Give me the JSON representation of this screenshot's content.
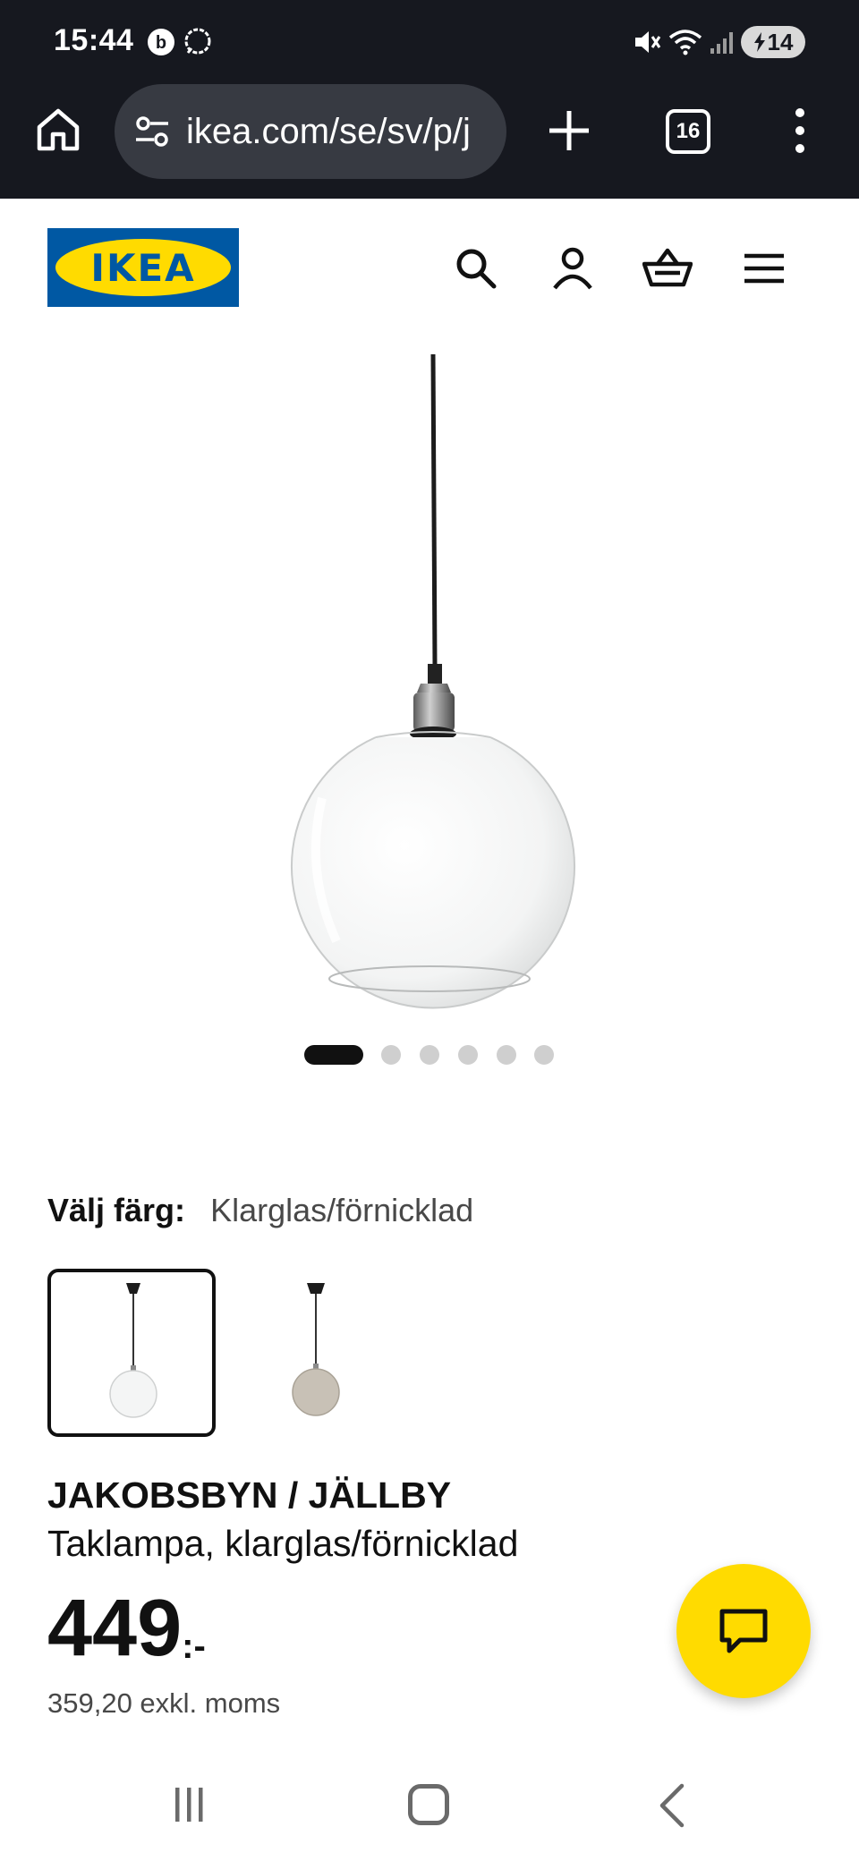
{
  "status_bar": {
    "time": "15:44",
    "battery_level": "14",
    "icons": [
      "b-app-icon",
      "signal-messenger-icon",
      "mute-icon",
      "wifi-icon",
      "cell-signal-icon",
      "battery-charging-icon"
    ]
  },
  "browser": {
    "url": "ikea.com/se/sv/p/j",
    "tab_count": "16",
    "icons": [
      "home-icon",
      "site-settings-icon",
      "new-tab-icon",
      "tabs-icon",
      "more-menu-icon"
    ]
  },
  "site_header": {
    "logo_text": "IKEA",
    "icons": [
      "search-icon",
      "account-icon",
      "cart-icon",
      "menu-icon"
    ],
    "colors": {
      "brand_blue": "#0058a3",
      "brand_yellow": "#ffdb00"
    }
  },
  "carousel": {
    "total_images": 6,
    "active_index": 0
  },
  "color_selector": {
    "label": "Välj färg:",
    "selected_value": "Klarglas/förnicklad",
    "swatches": [
      {
        "name": "clear-glass-nickel",
        "selected": true
      },
      {
        "name": "grey-glass",
        "selected": false
      }
    ]
  },
  "product": {
    "name": "JAKOBSBYN / JÄLLBY",
    "description": "Taklampa, klarglas/förnicklad",
    "price_integer": "449",
    "price_suffix": ":-",
    "price_excl_vat": "359,20 exkl. moms"
  },
  "chat_button": {
    "icon": "chat-icon",
    "color": "#ffdb00"
  },
  "android_nav": {
    "icons": [
      "recent-apps-icon",
      "home-nav-icon",
      "back-icon"
    ]
  }
}
